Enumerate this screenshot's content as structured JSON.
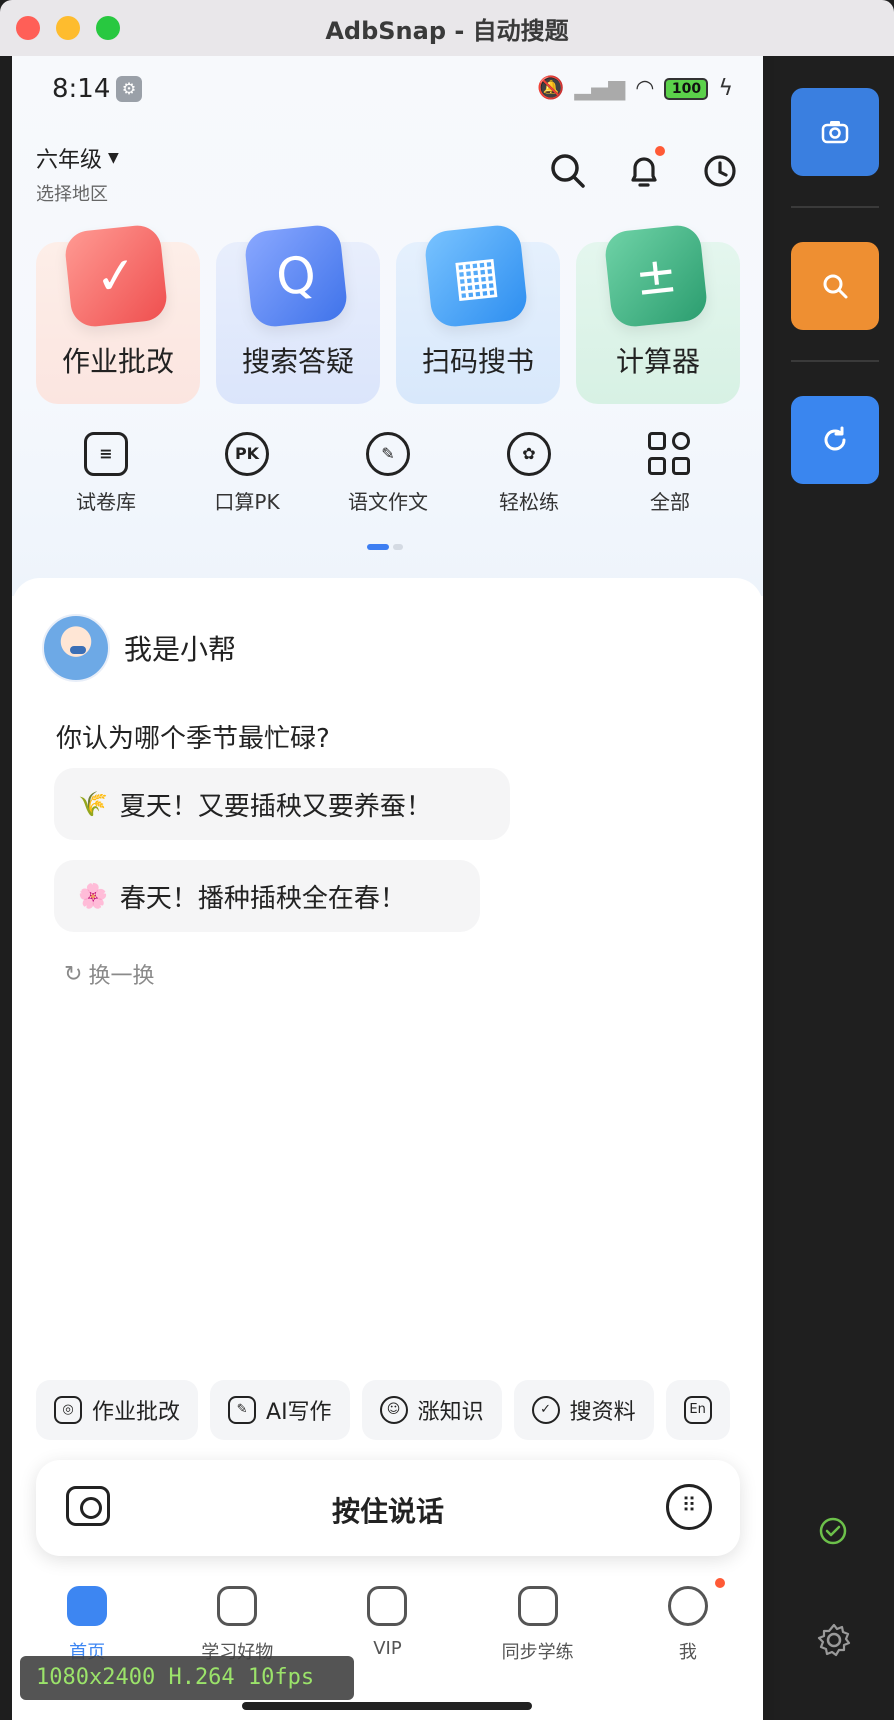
{
  "window": {
    "title": "AdbSnap - 自动搜题"
  },
  "status_bar": {
    "time": "8:14",
    "battery": "100"
  },
  "header": {
    "grade": "六年级",
    "region": "选择地区"
  },
  "big_tools": [
    {
      "label": "作业批改",
      "glyph": "✓"
    },
    {
      "label": "搜索答疑",
      "glyph": "Q"
    },
    {
      "label": "扫码搜书",
      "glyph": "▦"
    },
    {
      "label": "计算器",
      "glyph": "±"
    }
  ],
  "small_tools": [
    {
      "label": "试卷库",
      "glyph": "≡"
    },
    {
      "label": "口算PK",
      "glyph": "PK"
    },
    {
      "label": "语文作文",
      "glyph": "✎"
    },
    {
      "label": "轻松练",
      "glyph": "✿"
    },
    {
      "label": "全部",
      "glyph": ""
    }
  ],
  "chat": {
    "bot_name": "我是小帮",
    "question": "你认为哪个季节最忙碌?",
    "answers": [
      {
        "emoji": "🌾",
        "text": "夏天！又要插秧又要养蚕！"
      },
      {
        "emoji": "🌸",
        "text": "春天！播种插秧全在春！"
      }
    ],
    "refresh": "换一换"
  },
  "chips": [
    {
      "label": "作业批改",
      "icon": "◎"
    },
    {
      "label": "AI写作",
      "icon": "✎"
    },
    {
      "label": "涨知识",
      "icon": "☺"
    },
    {
      "label": "搜资料",
      "icon": "✓"
    },
    {
      "label": "",
      "icon": "En"
    }
  ],
  "voice": {
    "hold_to_talk": "按住说话",
    "keyboard_icon": "⠿"
  },
  "tabs": [
    {
      "label": "首页",
      "active": true
    },
    {
      "label": "学习好物",
      "active": false
    },
    {
      "label": "VIP",
      "active": false
    },
    {
      "label": "同步学练",
      "active": false
    },
    {
      "label": "我",
      "active": false
    }
  ],
  "overlay": {
    "stream_info": "1080x2400 H.264 10fps"
  },
  "colors": {
    "accent": "#3d86f2",
    "notice": "#ff5a36",
    "panel_orange": "#ee8f32",
    "panel_blue": "#3a7fe0"
  }
}
